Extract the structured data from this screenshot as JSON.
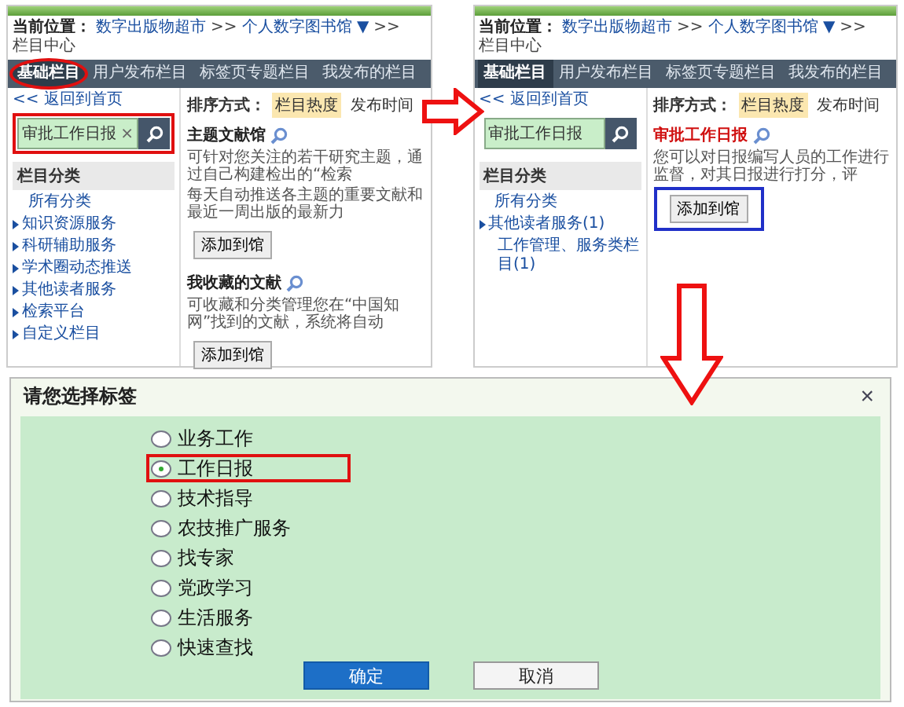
{
  "panels": [
    {
      "breadcrumb": [
        {
          "text": "当前位置：",
          "kind": "label"
        },
        {
          "text": "数字出版物超市",
          "kind": "link"
        },
        {
          "text": ">>",
          "kind": "sep"
        },
        {
          "text": "个人数字图书馆 ▼",
          "kind": "link"
        },
        {
          "text": ">>",
          "kind": "sep"
        },
        {
          "text": "栏目中心",
          "kind": "current"
        }
      ],
      "tabs": [
        {
          "label": "基础栏目",
          "selected": true,
          "marked": true
        },
        {
          "label": "用户发布栏目",
          "selected": false,
          "marked": false
        },
        {
          "label": "标签页专题栏目",
          "selected": false,
          "marked": false
        },
        {
          "label": "我发布的栏目",
          "selected": false,
          "marked": false
        }
      ],
      "back_link": "<< 返回到首页",
      "search": {
        "value": "审批工作日报",
        "clear": "×",
        "marked": true
      },
      "sidebar": {
        "heading": "栏目分类",
        "items": [
          {
            "label": "所有分类",
            "kind": "all"
          },
          {
            "label": "知识资源服务",
            "kind": "group"
          },
          {
            "label": "科研辅助服务",
            "kind": "group"
          },
          {
            "label": "学术圈动态推送",
            "kind": "group"
          },
          {
            "label": "其他读者服务",
            "kind": "group"
          },
          {
            "label": "检索平台",
            "kind": "group"
          },
          {
            "label": "自定义栏目",
            "kind": "group"
          }
        ]
      },
      "sort": {
        "label": "排序方式：",
        "options": [
          {
            "label": "栏目热度",
            "selected": true
          },
          {
            "label": "发布时间",
            "selected": false
          }
        ]
      },
      "columns": [
        {
          "title": "主题文献馆",
          "matched": false,
          "description": "可针对您关注的若干研究主题，通过自己构建检出的“检索",
          "description_2": "每天自动推送各主题的重要文献和最近一周出版的最新力",
          "button": "添加到馆",
          "marked": false
        },
        {
          "title": "我收藏的文献",
          "matched": false,
          "description": "可收藏和分类管理您在“中国知网”找到的文献，系统将自动",
          "button": "添加到馆",
          "marked": false
        }
      ]
    },
    {
      "breadcrumb": [
        {
          "text": "当前位置：",
          "kind": "label"
        },
        {
          "text": "数字出版物超市",
          "kind": "link"
        },
        {
          "text": ">>",
          "kind": "sep"
        },
        {
          "text": "个人数字图书馆 ▼",
          "kind": "link"
        },
        {
          "text": ">>",
          "kind": "sep"
        },
        {
          "text": "栏目中心",
          "kind": "current"
        }
      ],
      "tabs": [
        {
          "label": "基础栏目",
          "selected": true,
          "marked": false
        },
        {
          "label": "用户发布栏目",
          "selected": false,
          "marked": false
        },
        {
          "label": "标签页专题栏目",
          "selected": false,
          "marked": false
        },
        {
          "label": "我发布的栏目",
          "selected": false,
          "marked": false
        }
      ],
      "back_link": "<< 返回到首页",
      "search": {
        "value": "审批工作日报",
        "marked": false
      },
      "sidebar": {
        "heading": "栏目分类",
        "items": [
          {
            "label": "所有分类",
            "kind": "all"
          },
          {
            "label": "其他读者服务(1)",
            "kind": "group"
          },
          {
            "label": "工作管理、服务类栏目(1)",
            "kind": "sub"
          }
        ]
      },
      "sort": {
        "label": "排序方式：",
        "options": [
          {
            "label": "栏目热度",
            "selected": true
          },
          {
            "label": "发布时间",
            "selected": false
          }
        ]
      },
      "columns": [
        {
          "title": "审批工作日报",
          "matched": true,
          "description": "您可以对日报编写人员的工作进行监督，对其日报进行打分，评",
          "button": "添加到馆",
          "marked": true
        }
      ]
    }
  ],
  "dialog": {
    "title": "请您选择标签",
    "close": "×",
    "options": [
      {
        "label": "业务工作",
        "selected": false,
        "marked": false
      },
      {
        "label": "工作日报",
        "selected": true,
        "marked": true
      },
      {
        "label": "技术指导",
        "selected": false,
        "marked": false
      },
      {
        "label": "农技推广服务",
        "selected": false,
        "marked": false
      },
      {
        "label": "找专家",
        "selected": false,
        "marked": false
      },
      {
        "label": "党政学习",
        "selected": false,
        "marked": false
      },
      {
        "label": "生活服务",
        "selected": false,
        "marked": false
      },
      {
        "label": "快速查找",
        "selected": false,
        "marked": false
      }
    ],
    "buttons": [
      {
        "label": "确定",
        "kind": "primary"
      },
      {
        "label": "取消",
        "kind": "secondary"
      }
    ]
  }
}
